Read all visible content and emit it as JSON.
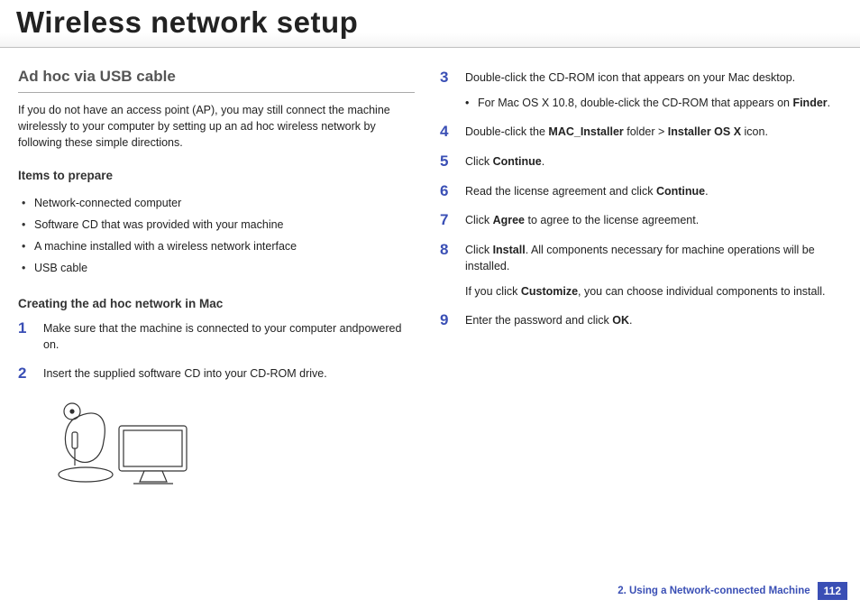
{
  "title": "Wireless network setup",
  "left": {
    "heading": "Ad hoc via USB cable",
    "intro": "If you do not have an access point (AP), you may still connect the machine wirelessly to your computer by setting up an ad hoc wireless network by following these simple directions.",
    "items_heading": "Items to prepare",
    "items": [
      "Network-connected computer",
      "Software CD that was provided with your machine",
      "A machine installed with a wireless network interface",
      "USB cable"
    ],
    "creating_heading": "Creating the ad hoc network in Mac",
    "step1_num": "1",
    "step1_text": "Make sure that the machine is connected to your computer andpowered on.",
    "step2_num": "2",
    "step2_text": "Insert the supplied software CD into your CD-ROM drive."
  },
  "right": {
    "step3_num": "3",
    "step3_text": "Double-click the CD-ROM icon that appears on your Mac desktop.",
    "step3_sub_pre": "For Mac OS X 10.8, double-click the CD-ROM that appears on ",
    "step3_sub_bold": "Finder",
    "step3_sub_post": ".",
    "step4_num": "4",
    "step4_pre": "Double-click the ",
    "step4_b1": "MAC_Installer",
    "step4_mid": " folder > ",
    "step4_b2": "Installer OS X",
    "step4_post": " icon.",
    "step5_num": "5",
    "step5_pre": "Click ",
    "step5_bold": "Continue",
    "step5_post": ".",
    "step6_num": "6",
    "step6_pre": "Read the license agreement and click ",
    "step6_bold": "Continue",
    "step6_post": ".",
    "step7_num": "7",
    "step7_pre": "Click ",
    "step7_bold": "Agree",
    "step7_post": " to agree to the license agreement.",
    "step8_num": "8",
    "step8_pre": "Click ",
    "step8_bold": "Install",
    "step8_post": ". All components necessary for machine operations will be installed.",
    "step8_p2_pre": "If you click ",
    "step8_p2_bold": "Customize",
    "step8_p2_post": ", you can choose individual components to install.",
    "step9_num": "9",
    "step9_pre": "Enter the password and click ",
    "step9_bold": "OK",
    "step9_post": "."
  },
  "footer": {
    "chapter": "2.  Using a Network-connected Machine",
    "page": "112"
  }
}
